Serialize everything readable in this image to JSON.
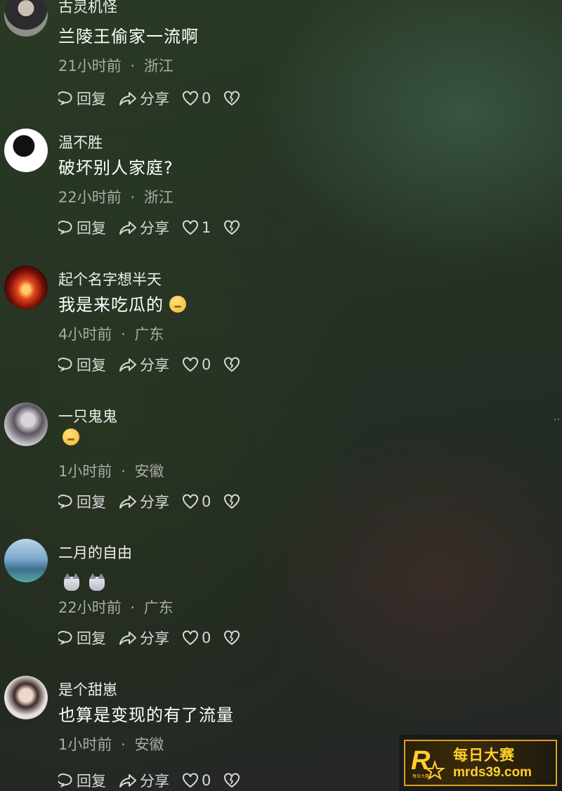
{
  "comments": [
    {
      "username": "古灵机怪",
      "content": "兰陵王偷家一流啊",
      "time": "21小时前",
      "location": "浙江",
      "reply": "回复",
      "share": "分享",
      "likes": "0"
    },
    {
      "username": "温不胜",
      "content": "破坏别人家庭?",
      "time": "22小时前",
      "location": "浙江",
      "reply": "回复",
      "share": "分享",
      "likes": "1"
    },
    {
      "username": "起个名字想半天",
      "content": "我是来吃瓜的",
      "time": "4小时前",
      "location": "广东",
      "reply": "回复",
      "share": "分享",
      "likes": "0"
    },
    {
      "username": "一只鬼鬼",
      "content": "",
      "time": "1小时前",
      "location": "安徽",
      "reply": "回复",
      "share": "分享",
      "likes": "0"
    },
    {
      "username": "二月的自由",
      "content": "",
      "time": "22小时前",
      "location": "广东",
      "reply": "回复",
      "share": "分享",
      "likes": "0"
    },
    {
      "username": "是个甜崽",
      "content": "也算是变现的有了流量",
      "time": "1小时前",
      "location": "安徽",
      "reply": "回复",
      "share": "分享",
      "likes": "0"
    }
  ],
  "meta_separator": "·",
  "watermark": {
    "title": "每日大赛",
    "url": "mrds39.com",
    "logo_letter": "R",
    "logo_small": "每日大赛"
  },
  "colors": {
    "accent": "#ffcf2e",
    "meta": "#a8aca6"
  }
}
